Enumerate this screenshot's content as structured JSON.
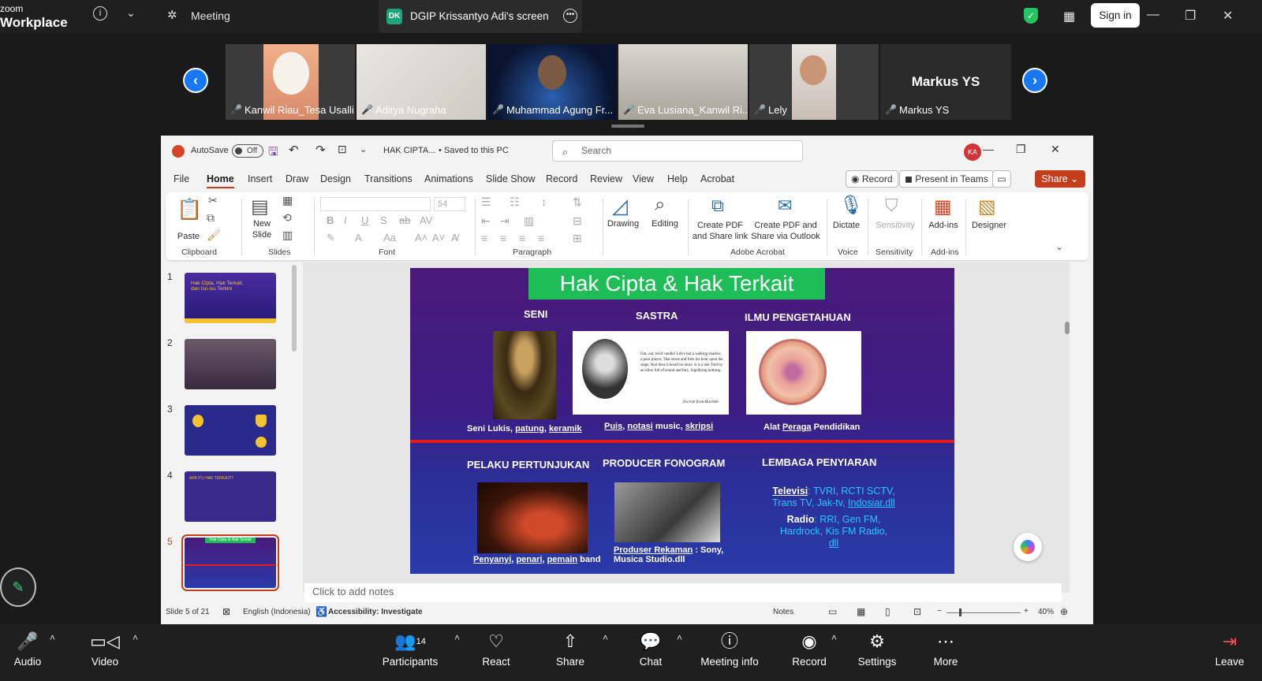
{
  "zoom": {
    "brand_line1": "zoom",
    "brand_line2": "Workplace",
    "meeting_label": "Meeting",
    "share_badge": "DK",
    "share_title": "DGIP Krissantyo Adi's screen",
    "signin_label": "Sign in",
    "participants": [
      {
        "name": "Kanwil Riau_Tesa Usalli..."
      },
      {
        "name": "Aditya Nugraha"
      },
      {
        "name": "Muhammad Agung Fr..."
      },
      {
        "name": "Eva Lusiana_Kanwil Ri..."
      },
      {
        "name": "Lely"
      },
      {
        "name": "Markus YS"
      }
    ],
    "big_name": "Markus YS",
    "toolbar": {
      "audio": "Audio",
      "video": "Video",
      "participants": "Participants",
      "participants_count": "14",
      "react": "React",
      "share": "Share",
      "chat": "Chat",
      "meeting_info": "Meeting info",
      "record": "Record",
      "settings": "Settings",
      "more": "More",
      "leave": "Leave"
    }
  },
  "ppt": {
    "autosave": "AutoSave",
    "autosave_state": "Off",
    "filename": "HAK CIPTA...",
    "saved": "• Saved to this PC",
    "search_placeholder": "Search",
    "avatar": "KA",
    "tabs": [
      "File",
      "Home",
      "Insert",
      "Draw",
      "Design",
      "Transitions",
      "Animations",
      "Slide Show",
      "Record",
      "Review",
      "View",
      "Help",
      "Acrobat"
    ],
    "record_btn": "Record",
    "present_btn": "Present in Teams",
    "share_btn": "Share",
    "ribbon": {
      "paste": "Paste",
      "clipboard": "Clipboard",
      "new_slide_1": "New",
      "new_slide_2": "Slide",
      "slides": "Slides",
      "font_size": "54",
      "font": "Font",
      "paragraph": "Paragraph",
      "drawing": "Drawing",
      "editing": "Editing",
      "create_pdf_1": "Create PDF",
      "create_pdf_2": "and Share link",
      "create_pdf_outlook_1": "Create PDF and",
      "create_pdf_outlook_2": "Share via Outlook",
      "adobe_acrobat": "Adobe Acrobat",
      "dictate": "Dictate",
      "voice": "Voice",
      "sensitivity_btn": "Sensitivity",
      "sensitivity": "Sensitivity",
      "addins_btn": "Add-ins",
      "addins": "Add-ins",
      "designer": "Designer"
    },
    "thumb_numbers": [
      "1",
      "2",
      "3",
      "4",
      "5"
    ],
    "thumb1_title": "Hak Cipta, Hak Terkait, dan Isu-isu Terkini",
    "thumb4_title": "APA ITU HAK TERKAIT?",
    "thumb5_title": "Hak Cipta & Hak Terkait",
    "slide": {
      "title": "Hak Cipta & Hak Terkait",
      "h_seni": "SENI",
      "h_sastra": "SASTRA",
      "h_ilmu": "ILMU PENGETAHUAN",
      "cap_seni_1": "Seni Lukis, ",
      "cap_seni_2": "patung",
      "cap_seni_3": ", ",
      "cap_seni_4": "keramik",
      "cap_sastra_1": "Puis",
      "cap_sastra_2": ", ",
      "cap_sastra_3": "notasi",
      "cap_sastra_4": " music, ",
      "cap_sastra_5": "skripsi",
      "cap_ilmu_1": "Alat ",
      "cap_ilmu_2": "Peraga",
      "cap_ilmu_3": " Pendidikan",
      "poem": "Out, out, brief candle! Life's but a walking shadow, a poor player, That struts and frets his hour upon the stage, And then is heard no more. It is a tale Told by an idiot, full of sound and fury, Signifying nothing.",
      "poem_source": "Excerpt from Macbeth",
      "h_pelaku": "PELAKU PERTUNJUKAN",
      "h_producer": "PRODUCER FONOGRAM",
      "h_lembaga": "LEMBAGA PENYIARAN",
      "cap_pelaku_1": "Penyanyi",
      "cap_pelaku_2": ", ",
      "cap_pelaku_3": "penari",
      "cap_pelaku_4": ", ",
      "cap_pelaku_5": "pemain",
      "cap_pelaku_6": " band",
      "cap_producer_1": "Produser Rekaman",
      "cap_producer_2": " : Sony,",
      "cap_producer_3": "Musica Studio.dll",
      "tv_label": "Televisi",
      "tv_text_1": ": TVRI, RCTI SCTV,",
      "tv_text_2": "Trans TV, Jak-tv, ",
      "tv_text_3": "Indosiar.dll",
      "radio_label": "Radio",
      "radio_text_1": ": RRI, Gen FM,",
      "radio_text_2": "Hardrock, Kis FM Radio,",
      "radio_text_3": "dll"
    },
    "notes_placeholder": "Click to add notes",
    "status": {
      "slide": "Slide 5 of 21",
      "language": "English (Indonesia)",
      "accessibility": "Accessibility: Investigate",
      "notes": "Notes",
      "zoom": "40%"
    }
  },
  "colors": {
    "zoom_blue": "#1877f2",
    "ppt_accent": "#c43e1c",
    "slide_title_green": "#1fbd57",
    "slide_red_line": "#e01d1d"
  }
}
